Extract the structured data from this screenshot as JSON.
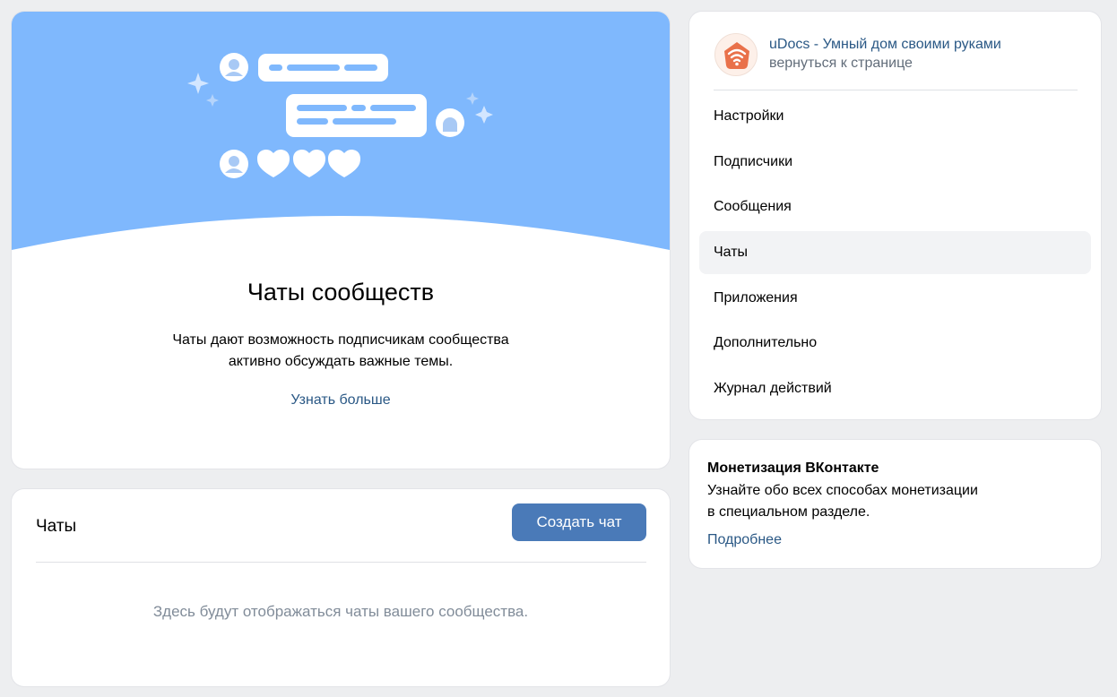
{
  "promo": {
    "title": "Чаты сообществ",
    "description_line1": "Чаты дают возможность подписчикам сообщества",
    "description_line2": "активно обсуждать важные темы.",
    "learn_more": "Узнать больше"
  },
  "chats": {
    "title": "Чаты",
    "create_button": "Создать чат",
    "empty_text": "Здесь будут отображаться чаты вашего сообщества."
  },
  "sidebar": {
    "community_name": "uDocs - Умный дом своими руками",
    "back_link": "вернуться к странице",
    "items": [
      {
        "label": "Настройки",
        "active": false
      },
      {
        "label": "Подписчики",
        "active": false
      },
      {
        "label": "Сообщения",
        "active": false
      },
      {
        "label": "Чаты",
        "active": true
      },
      {
        "label": "Приложения",
        "active": false
      },
      {
        "label": "Дополнительно",
        "active": false
      },
      {
        "label": "Журнал действий",
        "active": false
      }
    ]
  },
  "monetization": {
    "title": "Монетизация ВКонтакте",
    "text_line1": "Узнайте обо всех способах монетизации",
    "text_line2": "в специальном разделе.",
    "link": "Подробнее"
  },
  "colors": {
    "banner": "#7fb8fd",
    "link": "#2a5885",
    "button": "#4a7ab8",
    "avatar_accent": "#e9714a"
  }
}
